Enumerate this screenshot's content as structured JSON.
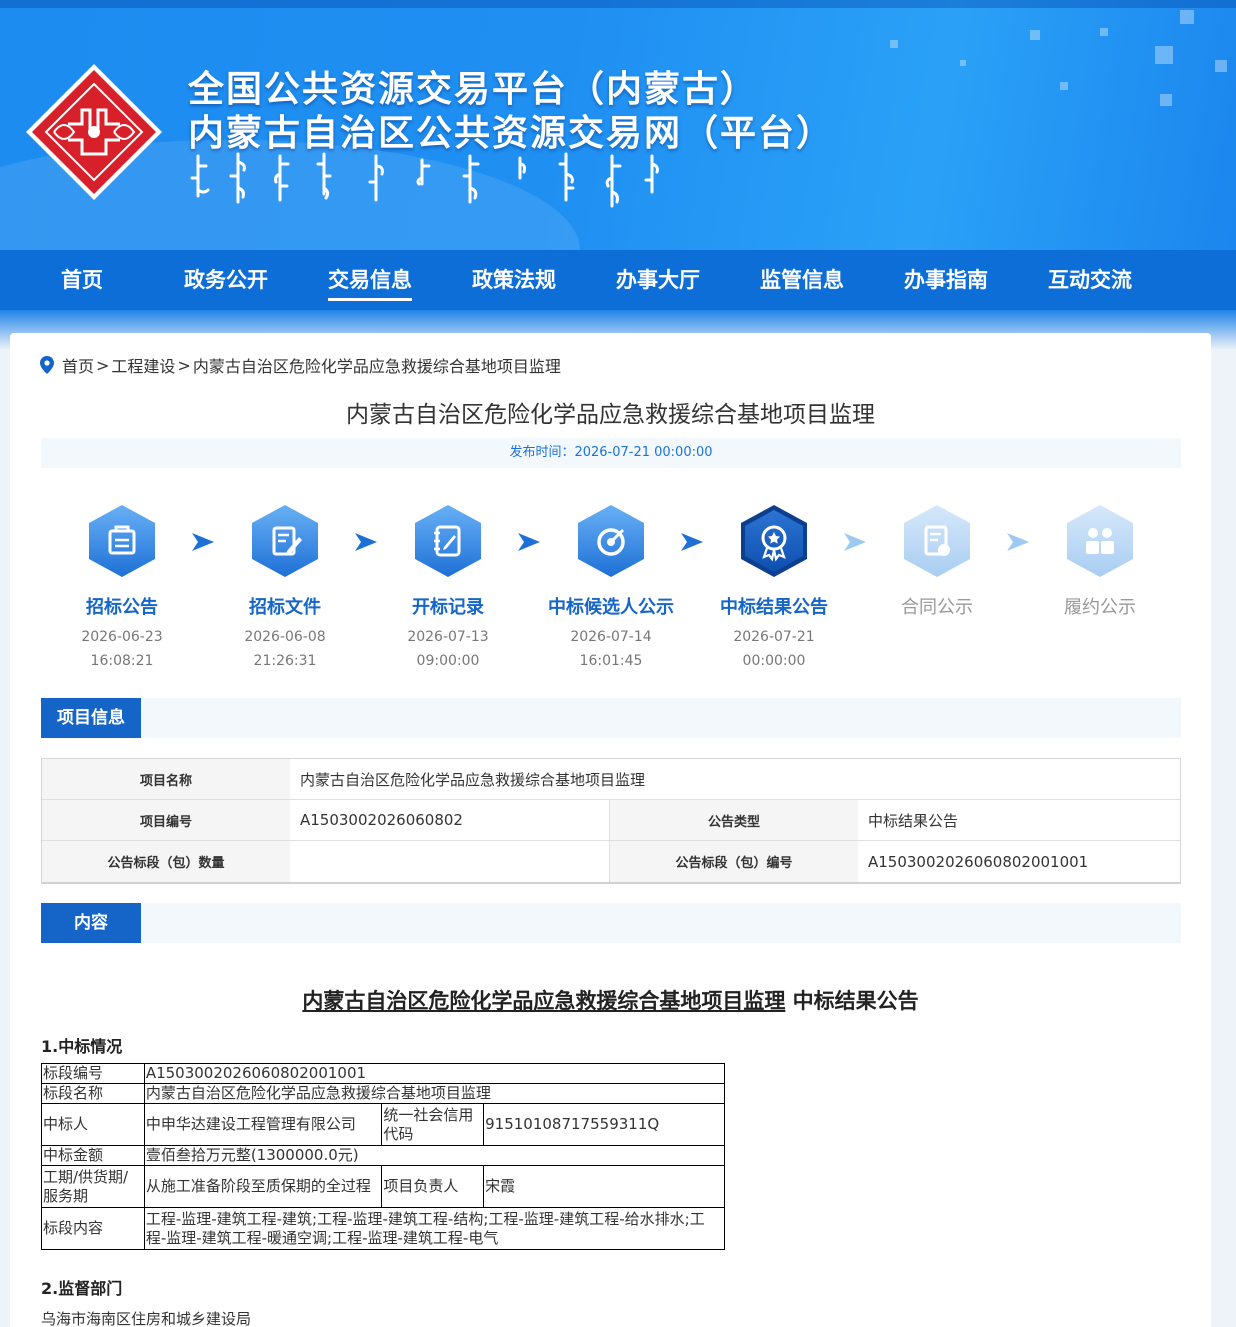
{
  "header": {
    "title_line1": "全国公共资源交易平台（内蒙古）",
    "title_line2": "内蒙古自治区公共资源交易网（平台）"
  },
  "nav": [
    {
      "label": "首页"
    },
    {
      "label": "政务公开"
    },
    {
      "label": "交易信息",
      "active": true
    },
    {
      "label": "政策法规"
    },
    {
      "label": "办事大厅"
    },
    {
      "label": "监管信息"
    },
    {
      "label": "办事指南"
    },
    {
      "label": "互动交流"
    }
  ],
  "breadcrumb": {
    "home": "首页",
    "sep1": ">",
    "category": "工程建设",
    "sep2": ">",
    "current": "内蒙古自治区危险化学品应急救援综合基地项目监理"
  },
  "page": {
    "title": "内蒙古自治区危险化学品应急救援综合基地项目监理",
    "publish": "发布时间：2026-07-21 00:00:00"
  },
  "steps": [
    {
      "label": "招标公告",
      "date": "2026-06-23",
      "time": "16:08:21",
      "icon": "bulletin-icon",
      "state": "done"
    },
    {
      "label": "招标文件",
      "date": "2026-06-08",
      "time": "21:26:31",
      "icon": "document-edit-icon",
      "state": "done"
    },
    {
      "label": "开标记录",
      "date": "2026-07-13",
      "time": "09:00:00",
      "icon": "notebook-icon",
      "state": "done"
    },
    {
      "label": "中标候选人公示",
      "date": "2026-07-14",
      "time": "16:01:45",
      "icon": "target-icon",
      "state": "done"
    },
    {
      "label": "中标结果公告",
      "date": "2026-07-21",
      "time": "00:00:00",
      "icon": "medal-icon",
      "state": "current"
    },
    {
      "label": "合同公示",
      "date": "",
      "time": "",
      "icon": "contract-icon",
      "state": "pending"
    },
    {
      "label": "履约公示",
      "date": "",
      "time": "",
      "icon": "people-icon",
      "state": "pending"
    }
  ],
  "project_info": {
    "section_label": "项目信息",
    "name_label": "项目名称",
    "name_value": "内蒙古自治区危险化学品应急救援综合基地项目监理",
    "code_label": "项目编号",
    "code_value": "A1503002026060802",
    "type_label": "公告类型",
    "type_value": "中标结果公告",
    "lot_count_label": "公告标段（包）数量",
    "lot_count_value": "",
    "lot_code_label": "公告标段（包）编号",
    "lot_code_value": "A1503002026060802001001"
  },
  "content": {
    "section_label": "内容",
    "title_project": "内蒙古自治区危险化学品应急救援综合基地项目监理",
    "title_suffix": " 中标结果公告",
    "h1": "1.中标情况",
    "rows": {
      "lot_code_k": "标段编号",
      "lot_code_v": "A1503002026060802001001",
      "lot_name_k": "标段名称",
      "lot_name_v": "内蒙古自治区危险化学品应急救援综合基地项目监理",
      "winner_k": "中标人",
      "winner_v": "中申华达建设工程管理有限公司",
      "credit_k": "统一社会信用代码",
      "credit_v": "91510108717559311Q",
      "amount_k": "中标金额",
      "amount_v": "壹佰叁拾万元整(1300000.0元)",
      "period_k": "工期/供货期/服务期",
      "period_v": "从施工准备阶段至质保期的全过程",
      "manager_k": "项目负责人",
      "manager_v": "宋霞",
      "scope_k": "标段内容",
      "scope_v": "工程-监理-建筑工程-建筑;工程-监理-建筑工程-结构;工程-监理-建筑工程-给水排水;工程-监理-建筑工程-暖通空调;工程-监理-建筑工程-电气"
    },
    "h2": "2.监督部门",
    "supervisor": "乌海市海南区住房和城乡建设局"
  }
}
